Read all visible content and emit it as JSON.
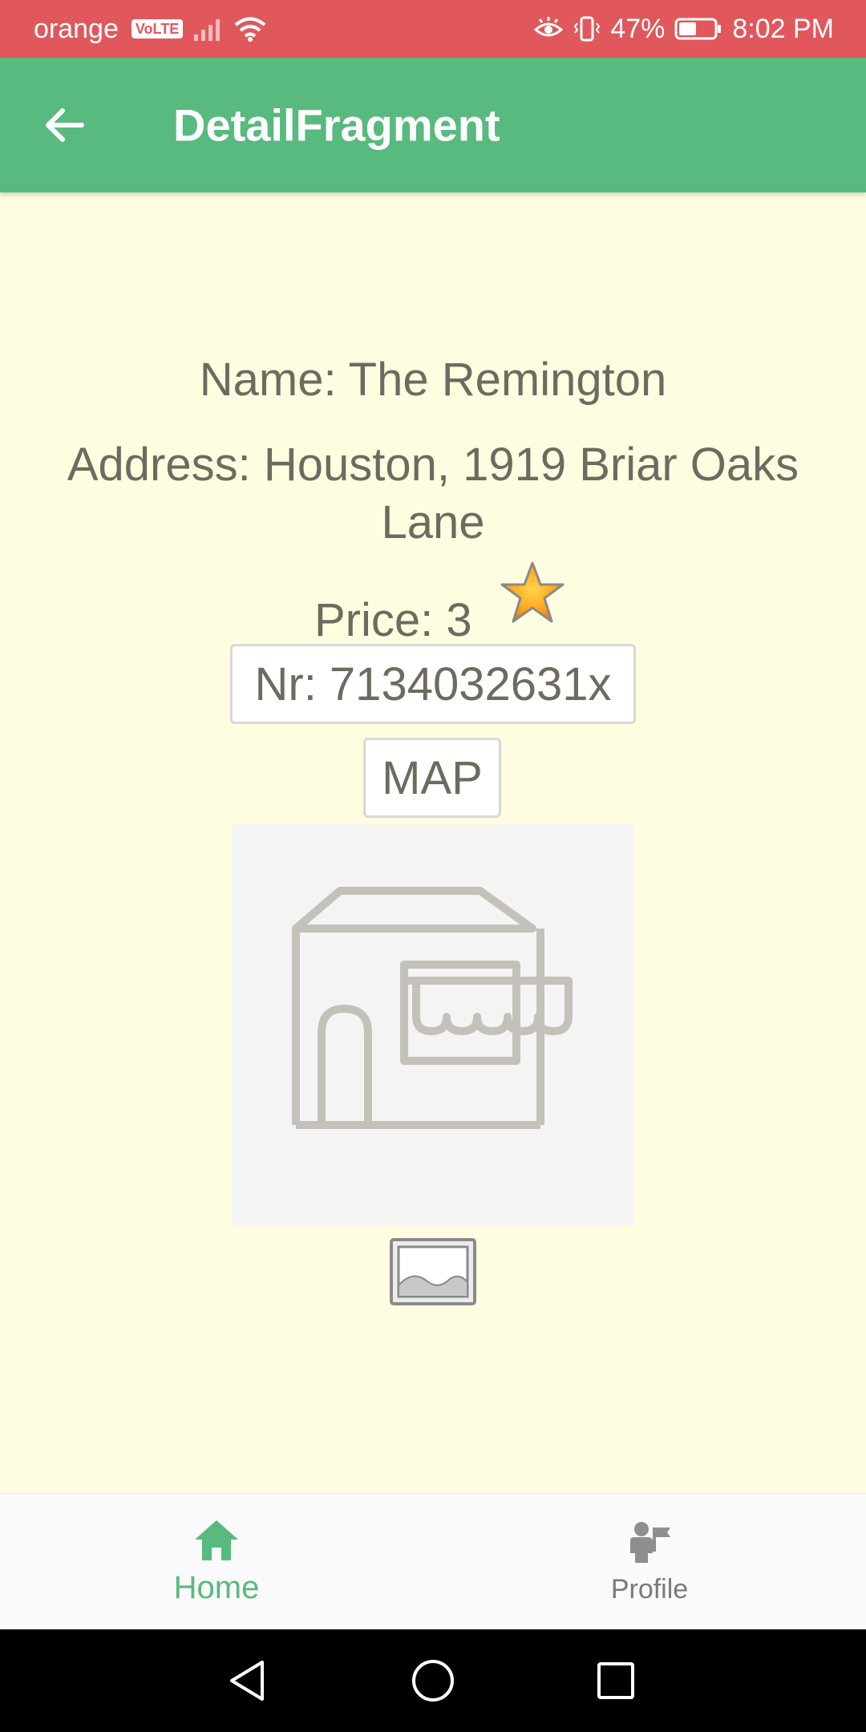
{
  "status_bar": {
    "carrier": "orange",
    "volte": "VoLTE",
    "battery": "47%",
    "time": "8:02 PM",
    "color": "#E0585C"
  },
  "app_bar": {
    "title": "DetailFragment",
    "color": "#58BA7E",
    "back_icon": "arrow-back-icon"
  },
  "detail": {
    "name": "Name: The Remington",
    "address": "Address: Houston, 1919 Briar Oaks Lane",
    "price": "Price: 3",
    "phone_button": "Nr: 7134032631x",
    "map_button": "MAP",
    "star_icon": "star-icon",
    "photo_placeholder_icon": "storefront-icon",
    "gallery_icon": "image-icon"
  },
  "bottom_nav": {
    "items": [
      {
        "label": "Home",
        "icon": "home-icon",
        "selected": true
      },
      {
        "label": "Profile",
        "icon": "profile-icon",
        "selected": false
      }
    ],
    "active_color": "#58BA7E"
  },
  "system_nav": {
    "buttons": [
      "back",
      "home",
      "recents"
    ]
  },
  "colors": {
    "background": "#FFFDE0",
    "text": "#6E6A60"
  }
}
